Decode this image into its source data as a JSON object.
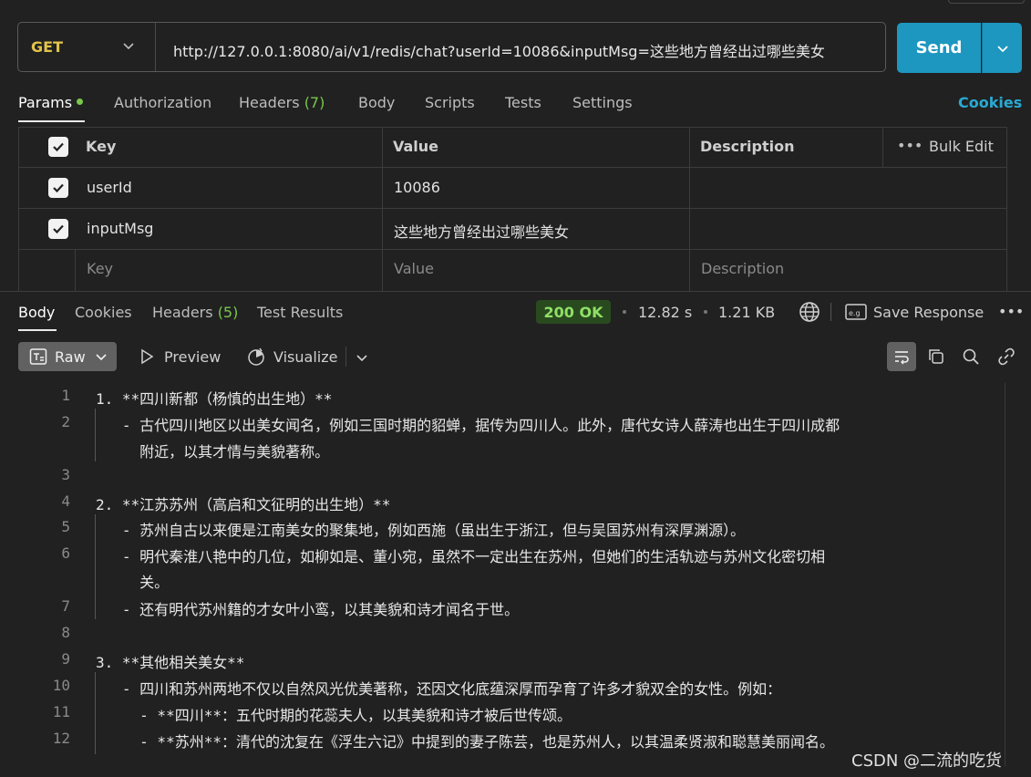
{
  "request": {
    "method": "GET",
    "url": "http://127.0.0.1:8080/ai/v1/redis/chat?userId=10086&inputMsg=这些地方曾经出过哪些美女",
    "send_label": "Send"
  },
  "request_tabs": [
    {
      "label": "Params"
    },
    {
      "label": "Authorization"
    },
    {
      "label": "Headers",
      "count": "(7)"
    },
    {
      "label": "Body"
    },
    {
      "label": "Scripts"
    },
    {
      "label": "Tests"
    },
    {
      "label": "Settings"
    }
  ],
  "cookies_label": "Cookies",
  "params": {
    "headers": {
      "key": "Key",
      "value": "Value",
      "description": "Description",
      "bulk_edit": "Bulk Edit"
    },
    "rows": [
      {
        "key": "userId",
        "value": "10086",
        "description": ""
      },
      {
        "key": "inputMsg",
        "value": "这些地方曾经出过哪些美女",
        "description": ""
      }
    ],
    "placeholder": {
      "key": "Key",
      "value": "Value",
      "description": "Description"
    }
  },
  "response_tabs": [
    {
      "label": "Body"
    },
    {
      "label": "Cookies"
    },
    {
      "label": "Headers",
      "count": "(5)"
    },
    {
      "label": "Test Results"
    }
  ],
  "response_meta": {
    "status": "200 OK",
    "time": "12.82 s",
    "size": "1.21 KB",
    "save_response": "Save Response"
  },
  "toolbar": {
    "raw": "Raw",
    "preview": "Preview",
    "visualize": "Visualize"
  },
  "code_lines": [
    {
      "n": "1",
      "text": "1. **四川新都（杨慎的出生地）**"
    },
    {
      "n": "2",
      "text": "   - 古代四川地区以出美女闻名，例如三国时期的貂蝉，据传为四川人。此外，唐代女诗人薛涛也出生于四川成都"
    },
    {
      "n": "",
      "text": "     附近，以其才情与美貌著称。"
    },
    {
      "n": "3",
      "text": ""
    },
    {
      "n": "4",
      "text": "2. **江苏苏州（高启和文征明的出生地）**"
    },
    {
      "n": "5",
      "text": "   - 苏州自古以来便是江南美女的聚集地，例如西施（虽出生于浙江，但与吴国苏州有深厚渊源）。"
    },
    {
      "n": "6",
      "text": "   - 明代秦淮八艳中的几位，如柳如是、董小宛，虽然不一定出生在苏州，但她们的生活轨迹与苏州文化密切相"
    },
    {
      "n": "",
      "text": "     关。"
    },
    {
      "n": "7",
      "text": "   - 还有明代苏州籍的才女叶小鸾，以其美貌和诗才闻名于世。"
    },
    {
      "n": "8",
      "text": ""
    },
    {
      "n": "9",
      "text": "3. **其他相关美女**"
    },
    {
      "n": "10",
      "text": "   - 四川和苏州两地不仅以自然风光优美著称，还因文化底蕴深厚而孕育了许多才貌双全的女性。例如："
    },
    {
      "n": "11",
      "text": "     - **四川**：五代时期的花蕊夫人，以其美貌和诗才被后世传颂。"
    },
    {
      "n": "12",
      "text": "     - **苏州**：清代的沈复在《浮生六记》中提到的妻子陈芸，也是苏州人，以其温柔贤淑和聪慧美丽闻名。"
    }
  ],
  "watermark": "CSDN @二流的吃货",
  "colors": {
    "accent": "#1d97bf",
    "method": "#e3c44a",
    "count": "#79c84b",
    "status_bg": "#294a1f",
    "status_text": "#8fe066",
    "link": "#2aa9d2"
  }
}
